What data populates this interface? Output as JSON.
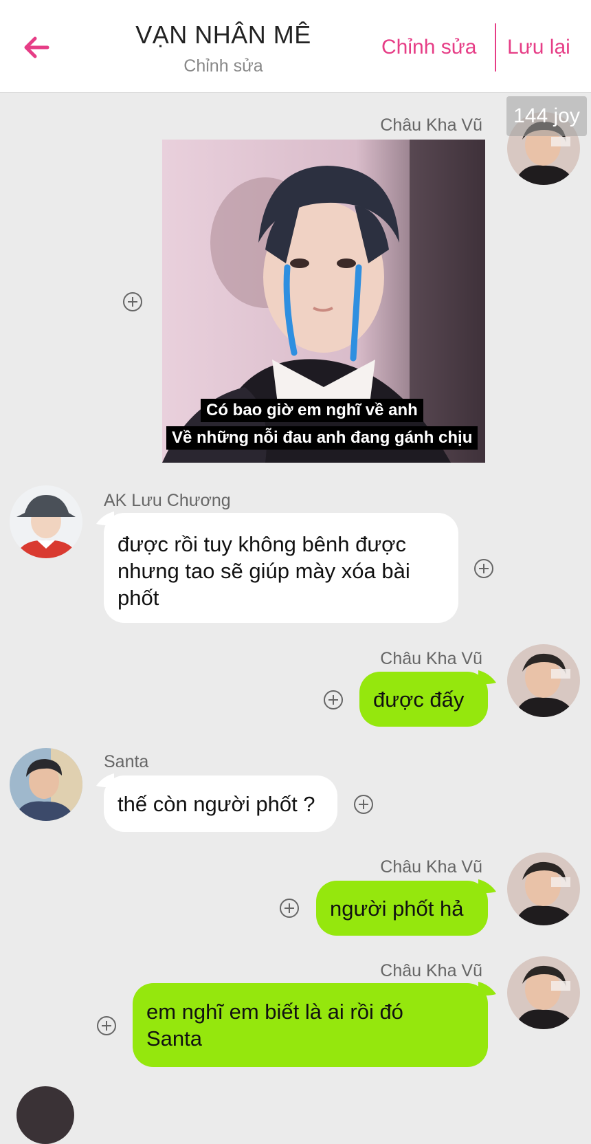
{
  "header": {
    "title": "VẠN NHÂN MÊ",
    "subtitle": "Chỉnh sửa",
    "edit_label": "Chỉnh sửa",
    "save_label": "Lưu lại",
    "accent_color": "#e63d86"
  },
  "badge": {
    "text": "144 joy"
  },
  "meme": {
    "caption_line1": "Có bao giờ em nghĩ về anh",
    "caption_line2": "Về những nỗi đau anh đang gánh chịu"
  },
  "messages": [
    {
      "sender": "Châu Kha Vũ",
      "side": "right",
      "type": "image"
    },
    {
      "sender": "AK Lưu Chương",
      "side": "left",
      "text": "được rồi tuy không bênh được\nnhưng tao sẽ giúp mày xóa bài\nphốt"
    },
    {
      "sender": "Châu Kha Vũ",
      "side": "right",
      "text": "được đấy"
    },
    {
      "sender": "Santa",
      "side": "left",
      "text": "thế còn người phốt ?"
    },
    {
      "sender": "Châu Kha Vũ",
      "side": "right",
      "text": "người phốt hả"
    },
    {
      "sender": "Châu Kha Vũ",
      "side": "right",
      "text": "em nghĩ em biết là ai rồi đó\nSanta"
    }
  ],
  "colors": {
    "background": "#ebebeb",
    "outgoing_bubble": "#95e70d",
    "incoming_bubble": "#ffffff"
  },
  "icons": {
    "back": "arrow-left-icon",
    "add_reaction": "plus-circle-icon"
  }
}
